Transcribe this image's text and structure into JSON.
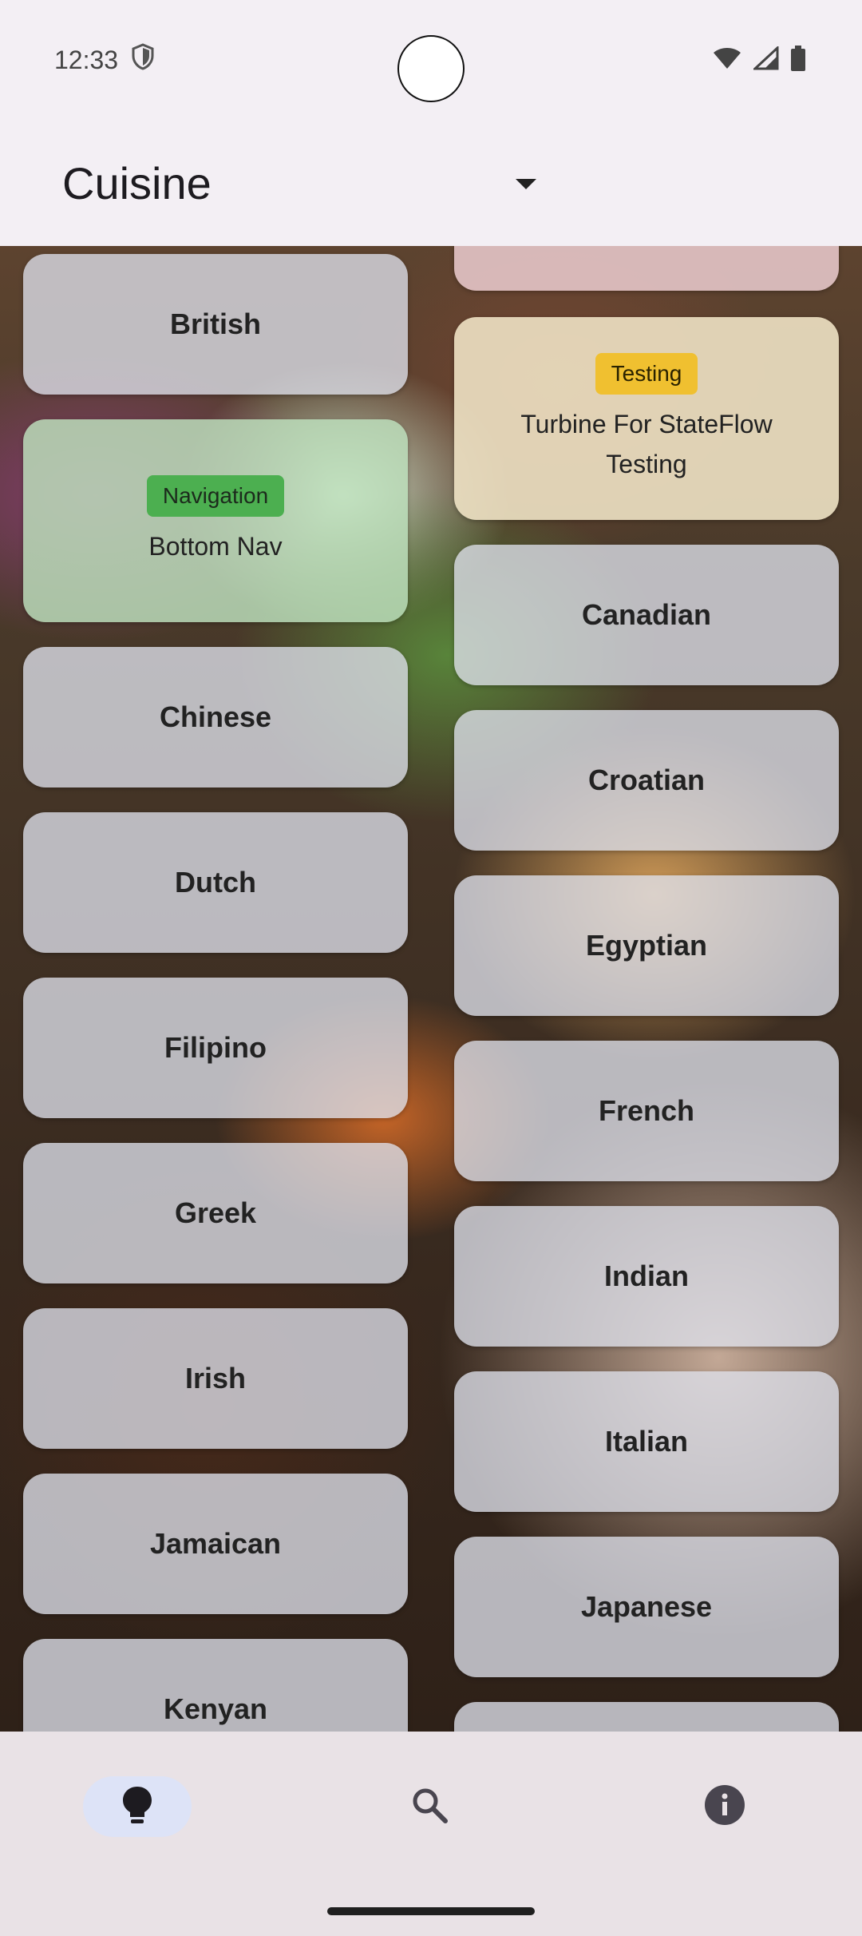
{
  "status_bar": {
    "time": "12:33"
  },
  "top_bar": {
    "title": "Cuisine"
  },
  "left_column": [
    {
      "label": "British"
    },
    {
      "tag": "Navigation",
      "label": "Bottom Nav"
    },
    {
      "label": "Chinese"
    },
    {
      "label": "Dutch"
    },
    {
      "label": "Filipino"
    },
    {
      "label": "Greek"
    },
    {
      "label": "Irish"
    },
    {
      "label": "Jamaican"
    },
    {
      "label": "Kenyan"
    }
  ],
  "right_column": [
    {
      "tag": "Testing",
      "label": "Turbine For StateFlow Testing"
    },
    {
      "label": "Canadian"
    },
    {
      "label": "Croatian"
    },
    {
      "label": "Egyptian"
    },
    {
      "label": "French"
    },
    {
      "label": "Indian"
    },
    {
      "label": "Italian"
    },
    {
      "label": "Japanese"
    }
  ],
  "bottom_nav": {
    "items": [
      {
        "icon": "lightbulb-icon",
        "active": true
      },
      {
        "icon": "search-icon",
        "active": false
      },
      {
        "icon": "info-icon",
        "active": false
      }
    ]
  },
  "colors": {
    "navigation_tag": "#4caf50",
    "testing_tag": "#f0c030",
    "active_nav_pill": "#dde3f7",
    "surface": "#f3eff4"
  }
}
